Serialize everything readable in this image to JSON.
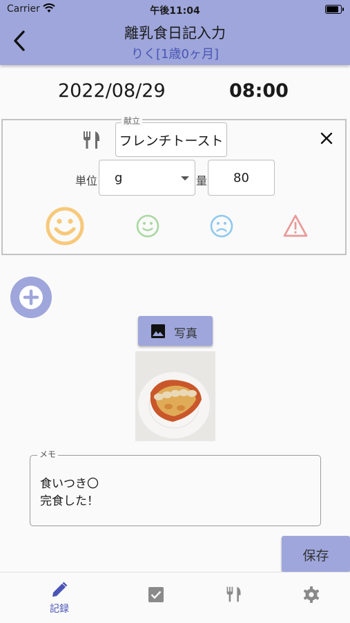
{
  "status": {
    "carrier": "Carrier",
    "time": "午後11:04",
    "battery_fraction": 0.95
  },
  "header": {
    "title": "離乳食日記入力",
    "subtitle": "りく[1歳0ヶ月]"
  },
  "datetime": {
    "date": "2022/08/29",
    "time": "08:00"
  },
  "entry": {
    "menu_label": "献立",
    "menu_value": "フレンチトースト",
    "unit_label": "単位",
    "unit_value": "g",
    "quantity_label": "量",
    "quantity_value": "80",
    "reactions": [
      "happy",
      "neutral",
      "sad",
      "warning"
    ],
    "selected_reaction": "happy"
  },
  "photo_button": {
    "label": "写真"
  },
  "memo": {
    "label": "メモ",
    "lines": [
      "食いつき〇",
      "完食した！"
    ]
  },
  "save_button": {
    "label": "保存"
  },
  "tabbar": {
    "items": [
      {
        "icon": "pencil-icon",
        "label": "記録",
        "active": true
      },
      {
        "icon": "checkbox-icon"
      },
      {
        "icon": "fork-knife-icon"
      },
      {
        "icon": "gear-icon"
      }
    ]
  },
  "colors": {
    "primary": "#9ea6db",
    "accent_text": "#4a55b5",
    "happy": "#f7c97a",
    "neutral": "#a8d8a0",
    "sad": "#8fc8ee",
    "warning": "#e89a9a"
  }
}
